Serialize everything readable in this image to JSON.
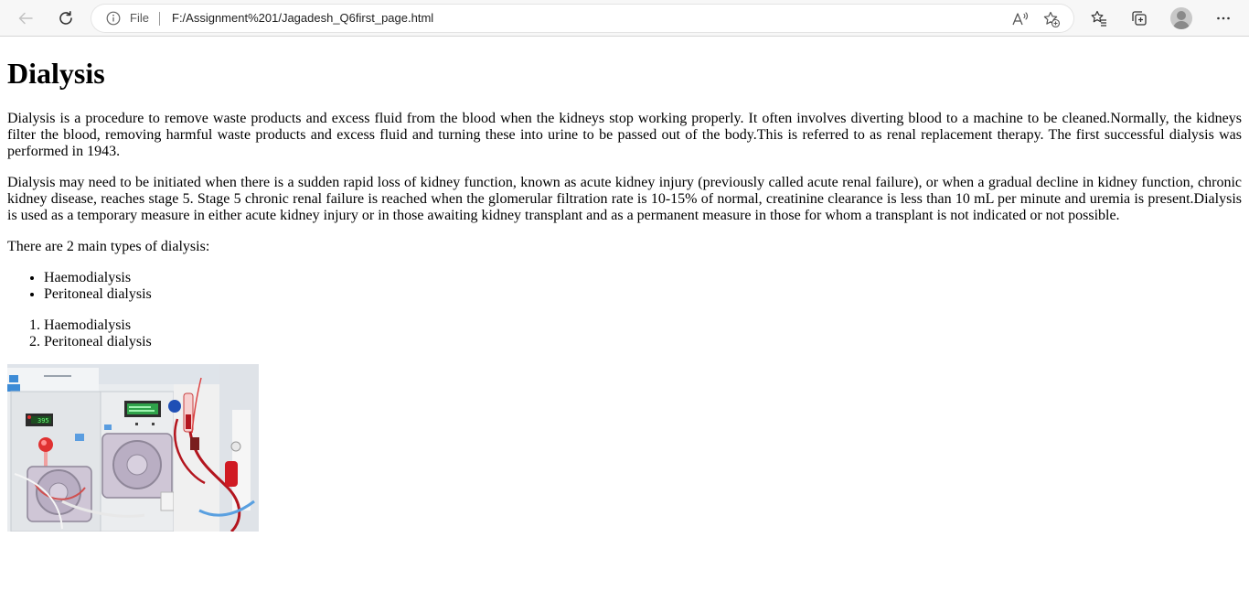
{
  "browser": {
    "address_prefix": "File",
    "url": "F:/Assignment%201/Jagadesh_Q6first_page.html",
    "readaloud_label": "A",
    "more_label": "···"
  },
  "page": {
    "heading": "Dialysis",
    "paragraphs": [
      "Dialysis is a procedure to remove waste products and excess fluid from the blood when the kidneys stop working properly. It often involves diverting blood to a machine to be cleaned.Normally, the kidneys filter the blood, removing harmful waste products and excess fluid and turning these into urine to be passed out of the body.This is referred to as renal replacement therapy. The first successful dialysis was performed in 1943.",
      "Dialysis may need to be initiated when there is a sudden rapid loss of kidney function, known as acute kidney injury (previously called acute renal failure), or when a gradual decline in kidney function, chronic kidney disease, reaches stage 5. Stage 5 chronic renal failure is reached when the glomerular filtration rate is 10-15% of normal, creatinine clearance is less than 10 mL per minute and uremia is present.Dialysis is used as a temporary measure in either acute kidney injury or in those awaiting kidney transplant and as a permanent measure in those for whom a transplant is not indicated or not possible.",
      "There are 2 main types of dialysis:"
    ],
    "unordered_list": [
      "Haemodialysis",
      "Peritoneal dialysis"
    ],
    "ordered_list": [
      "Haemodialysis",
      "Peritoneal dialysis"
    ],
    "image": {
      "icon": "dialysis-machine-photo",
      "display_reading": "395"
    }
  }
}
